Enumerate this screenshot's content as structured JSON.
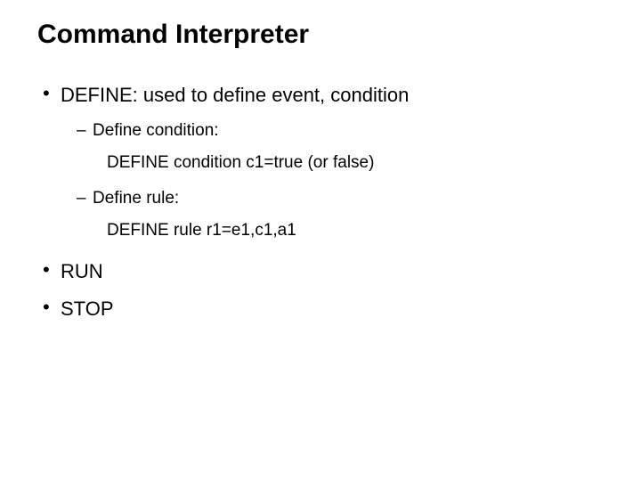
{
  "title": "Command Interpreter",
  "bullets": {
    "define": {
      "text": "DEFINE: used to define event, condition",
      "sub": {
        "cond": {
          "label": "Define condition:",
          "code": "DEFINE condition c1=true (or false)"
        },
        "rule": {
          "label": "Define rule:",
          "code": "DEFINE rule r1=e1,c1,a1"
        }
      }
    },
    "run": "RUN",
    "stop": "STOP"
  }
}
